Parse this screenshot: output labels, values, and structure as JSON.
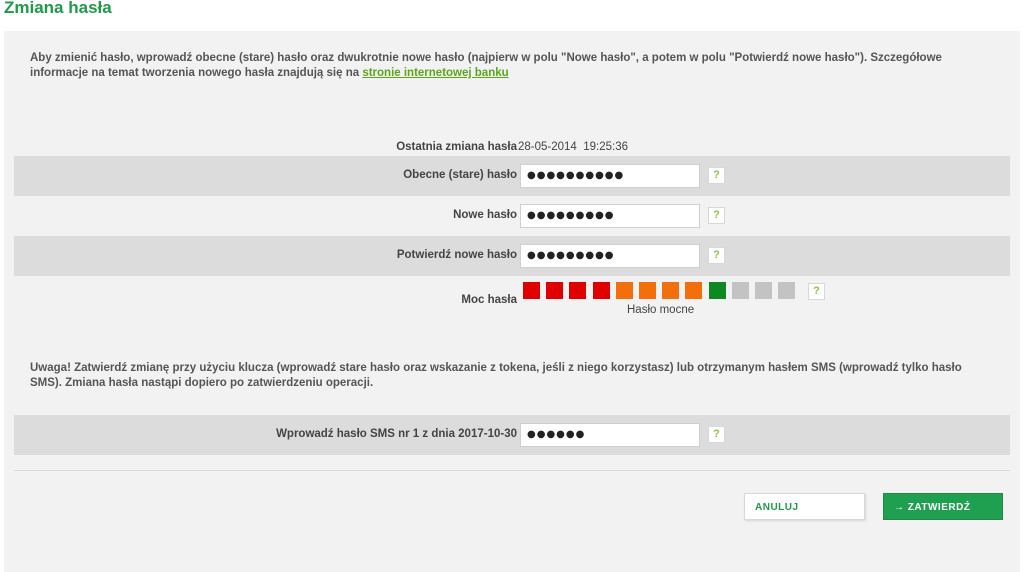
{
  "page": {
    "title": "Zmiana hasła"
  },
  "intro": {
    "text": "Aby zmienić hasło, wprowadź obecne (stare) hasło oraz dwukrotnie nowe hasło (najpierw w polu \"Nowe hasło\", a potem w polu \"Potwierdź nowe hasło\"). Szczegółowe informacje na temat tworzenia nowego hasła znajdują się na ",
    "link_text": "stronie internetowej banku"
  },
  "last_change": {
    "label": "Ostatnia zmiana hasła",
    "date": "28-05-2014",
    "time": "19:25:36"
  },
  "fields": {
    "old_password": {
      "label": "Obecne (stare) hasło",
      "value": "●●●●●●●●●●"
    },
    "new_password": {
      "label": "Nowe hasło",
      "value": "●●●●●●●●●"
    },
    "confirm_password": {
      "label": "Potwierdź nowe hasło",
      "value": "●●●●●●●●●"
    },
    "sms_password": {
      "label": "Wprowadź hasło SMS nr 1 z dnia 2017-10-30",
      "value": "●●●●●●"
    }
  },
  "help_symbol": "?",
  "strength": {
    "label": "Moc hasła",
    "text": "Hasło mocne",
    "level": 10,
    "total": 12,
    "colors": [
      "#e00000",
      "#e00000",
      "#e00000",
      "#e00000",
      "#f26f0c",
      "#f26f0c",
      "#f26f0c",
      "#f26f0c",
      "#0d8a1f",
      "#c3c3c3",
      "#c3c3c3",
      "#c3c3c3"
    ]
  },
  "note": "Uwaga! Zatwierdź zmianę przy użyciu klucza (wprowadź stare hasło oraz wskazanie z tokena, jeśli z niego korzystasz) lub otrzymanym hasłem SMS (wprowadź tylko hasło SMS). Zmiana hasła nastąpi dopiero po zatwierdzeniu operacji.",
  "buttons": {
    "cancel": "ANULUJ",
    "confirm": "→ ZATWIERDŹ"
  },
  "colors": {
    "brand": "#1f9a4a",
    "link": "#5ca61c",
    "help": "#8fc43a"
  }
}
